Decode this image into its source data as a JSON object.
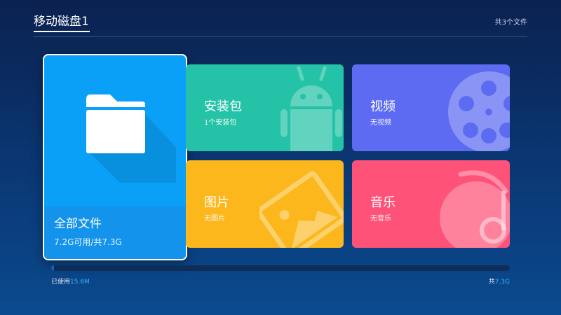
{
  "header": {
    "title": "移动磁盘1",
    "file_count": "共3个文件"
  },
  "tiles": {
    "all_files": {
      "name": "全部文件",
      "sub": "7.2G可用/共7.3G",
      "icon": "folder-icon",
      "color": "#0aa0f8"
    },
    "apk": {
      "name": "安装包",
      "sub": "1个安装包",
      "icon": "android-icon",
      "color": "#24c3a7"
    },
    "video": {
      "name": "视频",
      "sub": "无视频",
      "icon": "film-reel-icon",
      "color": "#5d6bf2"
    },
    "pictures": {
      "name": "图片",
      "sub": "无图片",
      "icon": "picture-icon",
      "color": "#fbb71c"
    },
    "music": {
      "name": "音乐",
      "sub": "无音乐",
      "icon": "music-disc-icon",
      "color": "#ff5278"
    }
  },
  "storage": {
    "used_prefix": "已使用",
    "used_value": "15.6M",
    "total_prefix": "共",
    "total_value": "7.3G",
    "used_fraction": 0.002
  }
}
